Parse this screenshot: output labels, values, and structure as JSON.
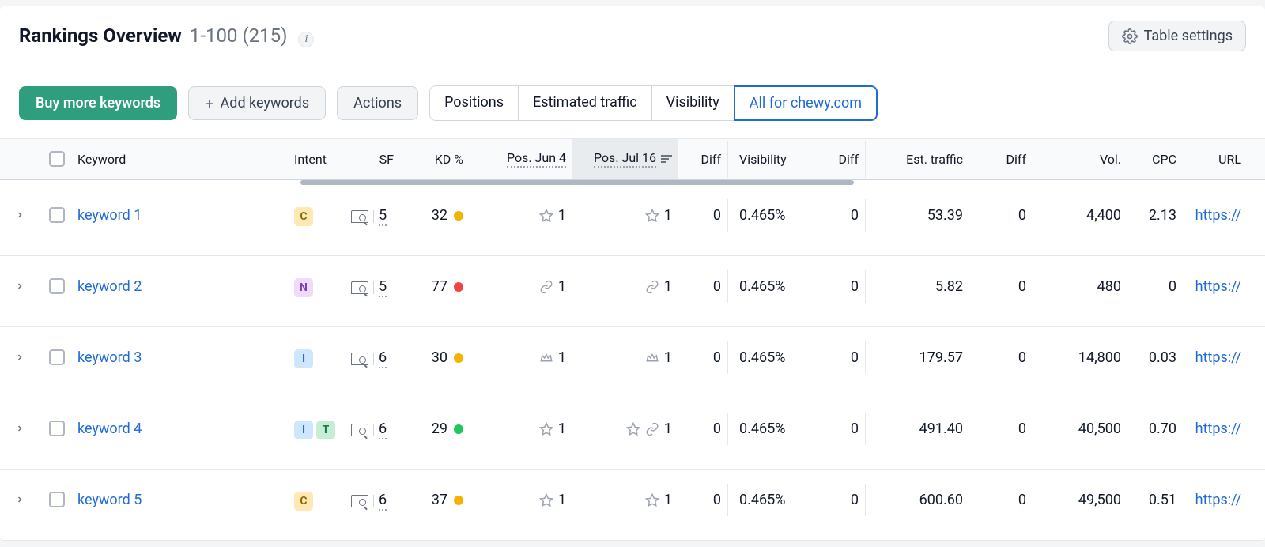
{
  "header": {
    "title": "Rankings Overview",
    "range": "1-100 (215)"
  },
  "settings_button": "Table settings",
  "toolbar": {
    "buy_more": "Buy more keywords",
    "add_kw": "Add keywords",
    "actions": "Actions",
    "tabs": [
      "Positions",
      "Estimated traffic",
      "Visibility",
      "All for chewy.com"
    ],
    "active_tab_index": 3
  },
  "columns": {
    "keyword": "Keyword",
    "intent": "Intent",
    "sf": "SF",
    "kd": "KD %",
    "pos1": "Pos. Jun 4",
    "pos2": "Pos. Jul 16",
    "diff": "Diff",
    "visibility": "Visibility",
    "est_traffic": "Est. traffic",
    "vol": "Vol.",
    "cpc": "CPC",
    "url": "URL"
  },
  "rows": [
    {
      "keyword": "keyword 1",
      "intents": [
        "C"
      ],
      "sf": "5",
      "kd": 32,
      "kd_color": "yellow",
      "pos1": "1",
      "pos1_icons": [
        "star"
      ],
      "pos2": "1",
      "pos2_icons": [
        "star"
      ],
      "diff1": 0,
      "visibility": "0.465%",
      "diff2": 0,
      "traffic": "53.39",
      "diff3": 0,
      "vol": "4,400",
      "cpc": "2.13",
      "url": "https://"
    },
    {
      "keyword": "keyword 2",
      "intents": [
        "N"
      ],
      "sf": "5",
      "kd": 77,
      "kd_color": "red",
      "pos1": "1",
      "pos1_icons": [
        "link"
      ],
      "pos2": "1",
      "pos2_icons": [
        "link"
      ],
      "diff1": 0,
      "visibility": "0.465%",
      "diff2": 0,
      "traffic": "5.82",
      "diff3": 0,
      "vol": "480",
      "cpc": "0",
      "url": "https://"
    },
    {
      "keyword": "keyword 3",
      "intents": [
        "I"
      ],
      "sf": "6",
      "kd": 30,
      "kd_color": "yellow",
      "pos1": "1",
      "pos1_icons": [
        "crown"
      ],
      "pos2": "1",
      "pos2_icons": [
        "crown"
      ],
      "diff1": 0,
      "visibility": "0.465%",
      "diff2": 0,
      "traffic": "179.57",
      "diff3": 0,
      "vol": "14,800",
      "cpc": "0.03",
      "url": "https://"
    },
    {
      "keyword": "keyword 4",
      "intents": [
        "I",
        "T"
      ],
      "sf": "6",
      "kd": 29,
      "kd_color": "green",
      "pos1": "1",
      "pos1_icons": [
        "star"
      ],
      "pos2": "1",
      "pos2_icons": [
        "star",
        "link"
      ],
      "diff1": 0,
      "visibility": "0.465%",
      "diff2": 0,
      "traffic": "491.40",
      "diff3": 0,
      "vol": "40,500",
      "cpc": "0.70",
      "url": "https://"
    },
    {
      "keyword": "keyword 5",
      "intents": [
        "C"
      ],
      "sf": "6",
      "kd": 37,
      "kd_color": "yellow",
      "pos1": "1",
      "pos1_icons": [
        "star"
      ],
      "pos2": "1",
      "pos2_icons": [
        "star"
      ],
      "diff1": 0,
      "visibility": "0.465%",
      "diff2": 0,
      "traffic": "600.60",
      "diff3": 0,
      "vol": "49,500",
      "cpc": "0.51",
      "url": "https://"
    }
  ]
}
